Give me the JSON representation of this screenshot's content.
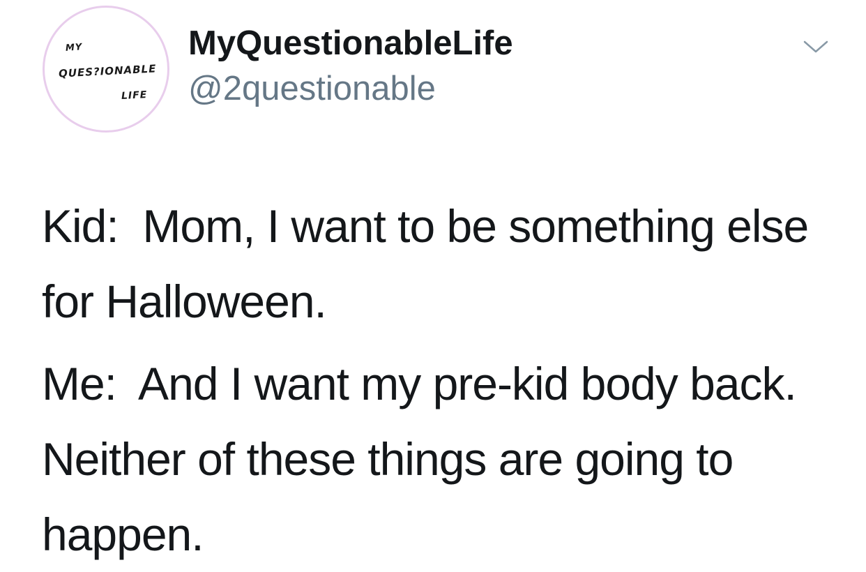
{
  "tweet": {
    "avatar": {
      "line1": "MY",
      "line2": "QUES?IONABLE",
      "line3": "LIFE",
      "ring_color": "#e8cdec"
    },
    "display_name": "MyQuestionableLife",
    "handle": "@2questionable",
    "menu_icon": "chevron-down-icon",
    "paragraphs": [
      "Kid:  Mom, I want to be something else for Halloween.",
      "Me:  And I want my pre-kid body back. Neither of these things are going to happen."
    ],
    "colors": {
      "text": "#14171a",
      "secondary": "#657786",
      "chevron": "#8899a6"
    }
  }
}
